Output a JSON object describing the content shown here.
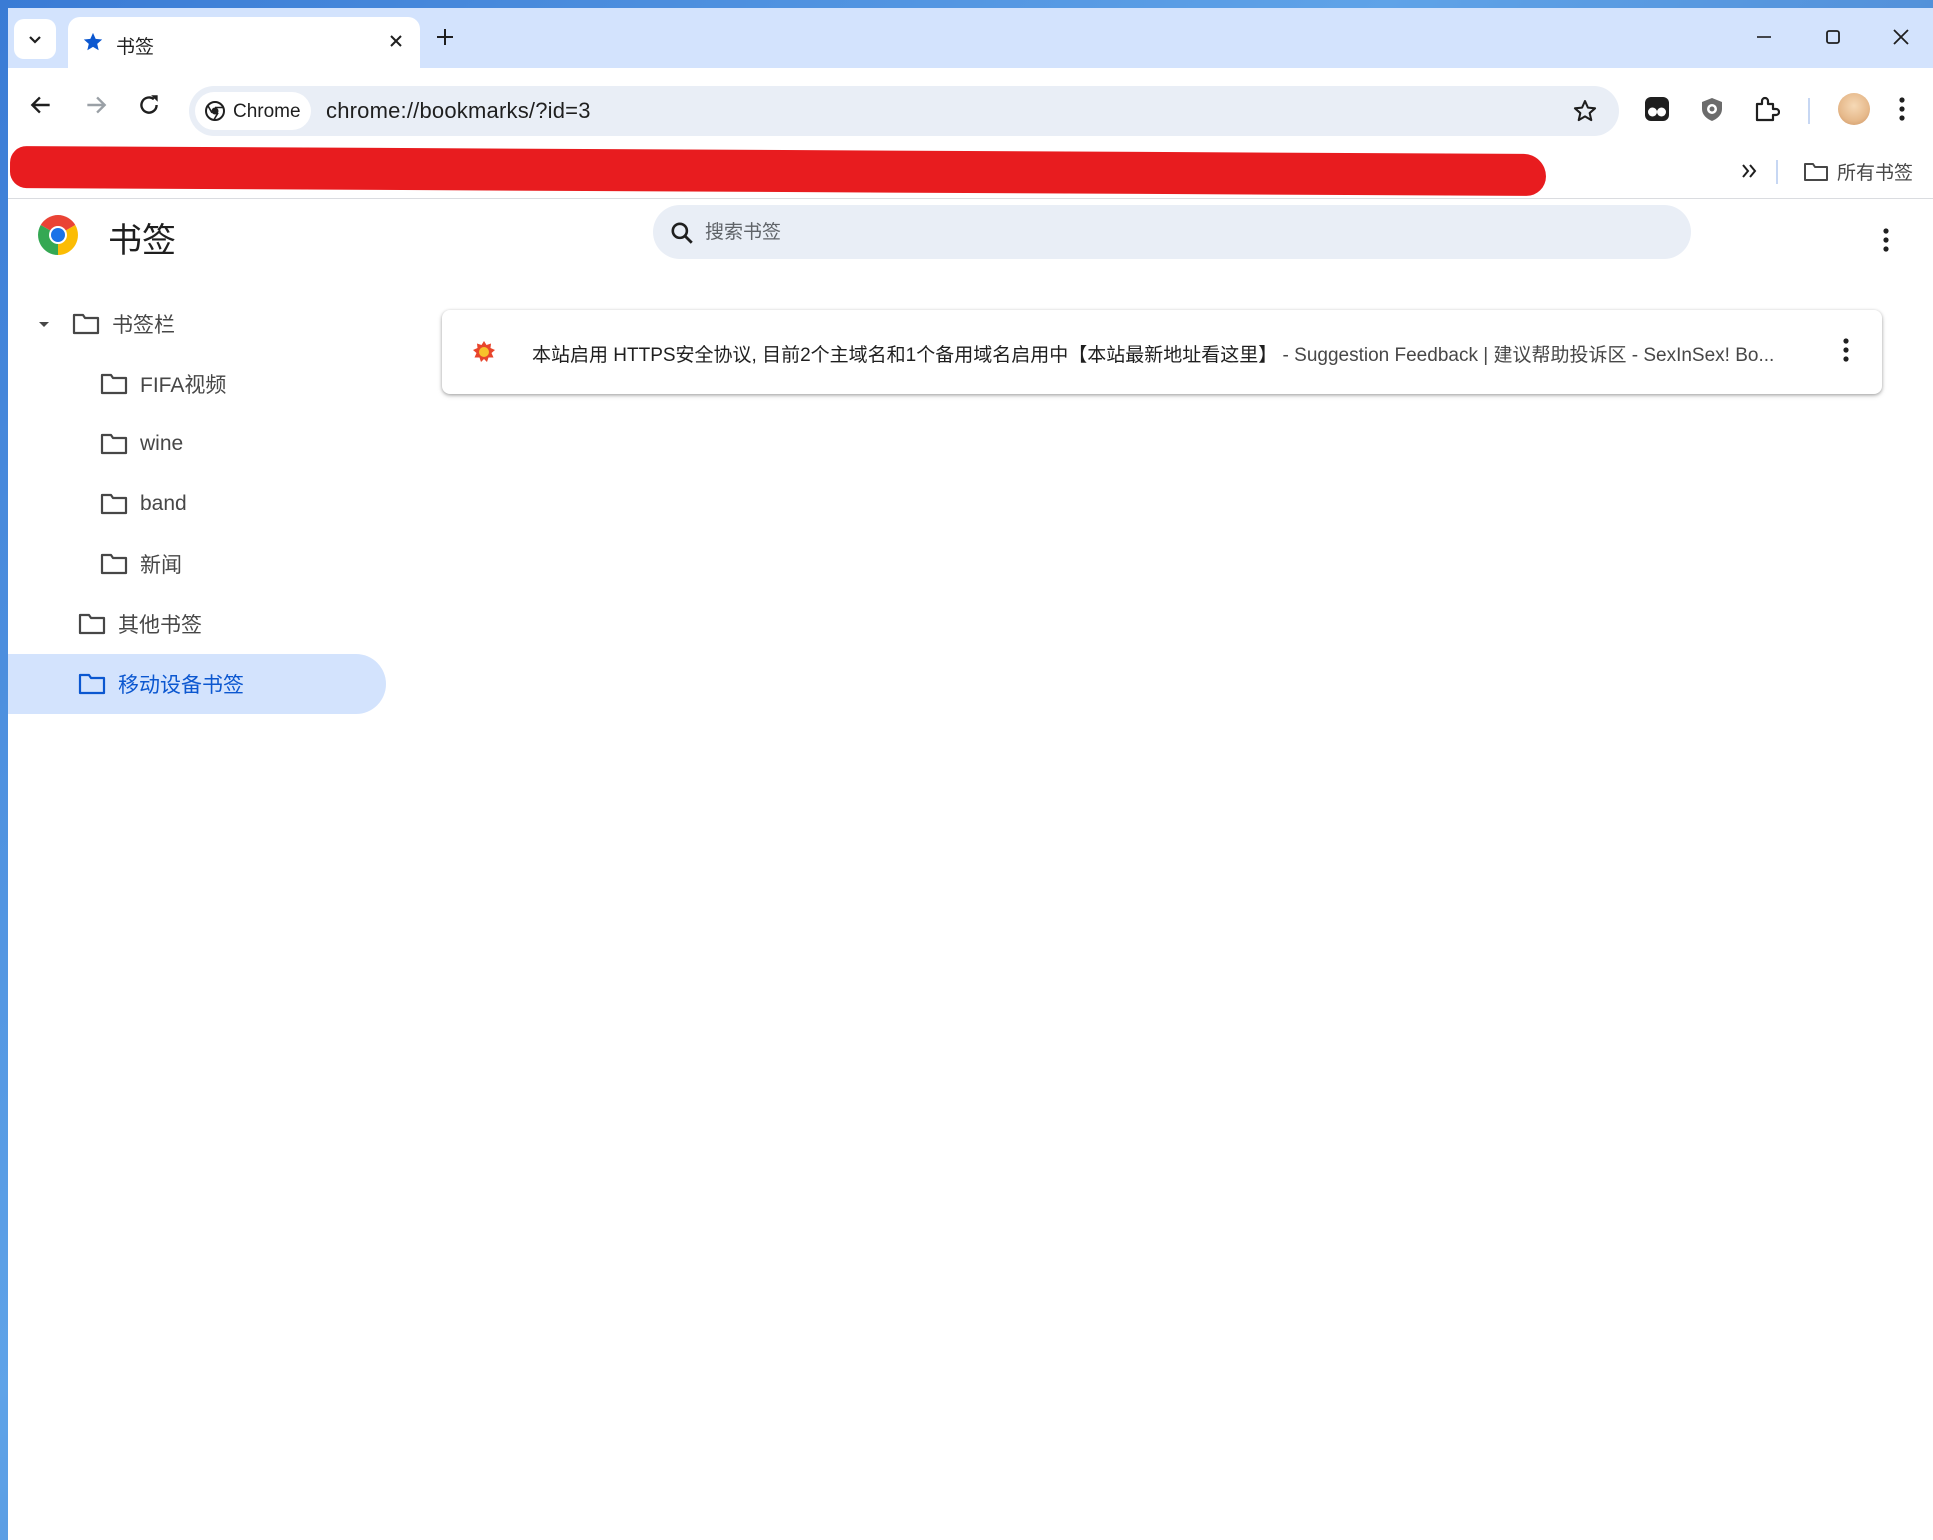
{
  "tab": {
    "title": "书签"
  },
  "toolbar": {
    "chip_label": "Chrome",
    "url": "chrome://bookmarks/?id=3"
  },
  "bookmarks_bar": {
    "all_bookmarks_label": "所有书签"
  },
  "page": {
    "title": "书签",
    "search_placeholder": "搜索书签"
  },
  "sidebar": {
    "items": [
      {
        "label": "书签栏",
        "expanded": true,
        "level": 0
      },
      {
        "label": "FIFA视频",
        "level": 1
      },
      {
        "label": "wine",
        "level": 1
      },
      {
        "label": "band",
        "level": 1
      },
      {
        "label": "新闻",
        "level": 1
      },
      {
        "label": "其他书签",
        "level": 0
      },
      {
        "label": "移动设备书签",
        "level": 0,
        "selected": true
      }
    ]
  },
  "bookmark_list": [
    {
      "title": "本站启用 HTTPS安全协议, 目前2个主域名和1个备用域名启用中【本站最新地址看这里】",
      "url_text": "- Suggestion Feedback | 建议帮助投诉区 - SexInSex! Bo..."
    }
  ],
  "colors": {
    "accent": "#0b57d0",
    "tabstrip": "#d3e3fd",
    "selected_bg": "#d3e3fd",
    "omnibox_bg": "#e9eef6"
  }
}
